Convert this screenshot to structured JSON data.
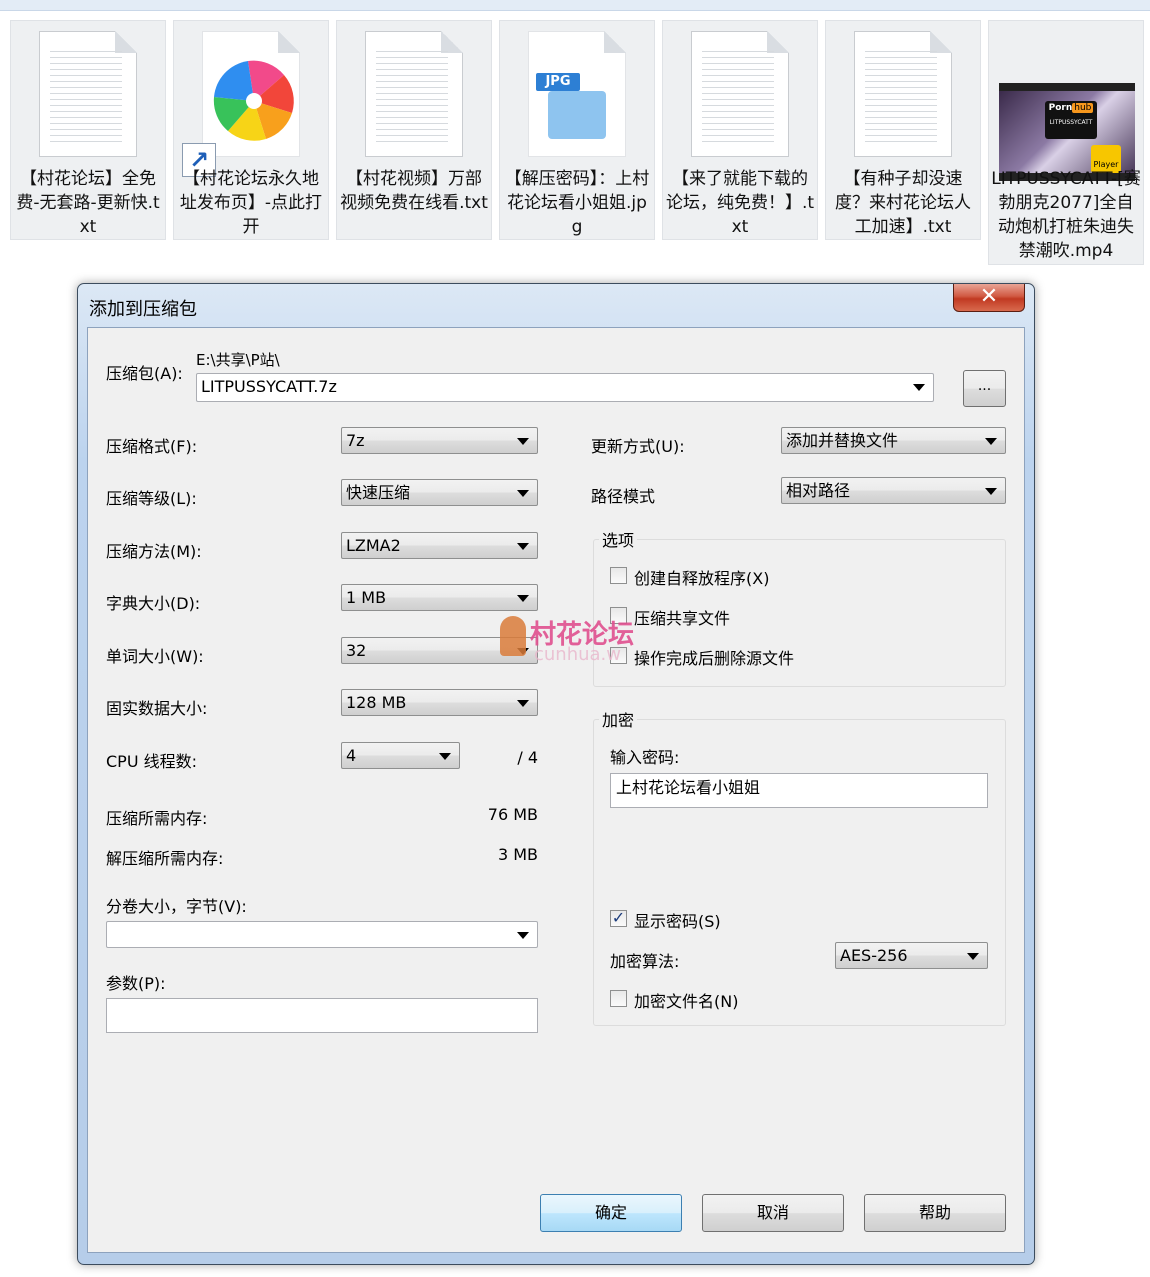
{
  "files": [
    {
      "name": "【村花论坛】全免费-无套路-更新快.txt",
      "icon": "text-file-icon"
    },
    {
      "name": "【村花论坛永久地址发布页】-点此打开",
      "icon": "browser-shortcut-icon"
    },
    {
      "name": "【村花视频】万部视频免费在线看.txt",
      "icon": "text-file-icon"
    },
    {
      "name": "【解压密码】：上村花论坛看小姐姐.jpg",
      "icon": "jpg-file-icon",
      "badge": "JPG"
    },
    {
      "name": "【来了就能下载的论坛，纯免费！】.txt",
      "icon": "text-file-icon"
    },
    {
      "name": "【有种子却没速度？来村花论坛人工加速】.txt",
      "icon": "text-file-icon"
    },
    {
      "name": "LITPUSSYCATT-[赛勃朋克2077]全自动炮机打桩朱迪失禁潮吹.mp4",
      "icon": "video-file-icon",
      "badge_brand": "Porn",
      "badge_brand_hl": "hub",
      "badge_sub": "LITPUSSYCATT",
      "player_label": "Player"
    }
  ],
  "dialog": {
    "title": "添加到压缩包",
    "close_glyph": "✕",
    "archive_label": "压缩包(A):",
    "archive_path": "E:\\共享\\P站\\",
    "archive_name": "LITPUSSYCATT.7z",
    "browse_label": "...",
    "format_label": "压缩格式(F):",
    "format_value": "7z",
    "level_label": "压缩等级(L):",
    "level_value": "快速压缩",
    "method_label": "压缩方法(M):",
    "method_value": "LZMA2",
    "dict_label": "字典大小(D):",
    "dict_value": "1 MB",
    "word_label": "单词大小(W):",
    "word_value": "32",
    "solid_label": "固实数据大小:",
    "solid_value": "128 MB",
    "cpu_label": "CPU 线程数:",
    "cpu_value": "4",
    "cpu_total": "/ 4",
    "mem_comp_label": "压缩所需内存:",
    "mem_comp_value": "76 MB",
    "mem_decomp_label": "解压缩所需内存:",
    "mem_decomp_value": "3 MB",
    "split_label": "分卷大小，字节(V):",
    "split_value": "",
    "params_label": "参数(P):",
    "params_value": "",
    "update_label": "更新方式(U):",
    "update_value": "添加并替换文件",
    "path_label": "路径模式",
    "path_value": "相对路径",
    "options": {
      "title": "选项",
      "sfx_label": "创建自释放程序(X)",
      "sfx_checked": false,
      "shared_label": "压缩共享文件",
      "shared_checked": false,
      "delete_label": "操作完成后删除源文件",
      "delete_checked": false
    },
    "encryption": {
      "title": "加密",
      "password_label": "输入密码:",
      "password_value": "上村花论坛看小姐姐",
      "show_label": "显示密码(S)",
      "show_checked": true,
      "algo_label": "加密算法:",
      "algo_value": "AES-256",
      "encrypt_names_label": "加密文件名(N)",
      "encrypt_names_checked": false
    },
    "ok_label": "确定",
    "cancel_label": "取消",
    "help_label": "帮助"
  },
  "watermark": {
    "title": "村花论坛",
    "sub": "cunhua.w"
  }
}
